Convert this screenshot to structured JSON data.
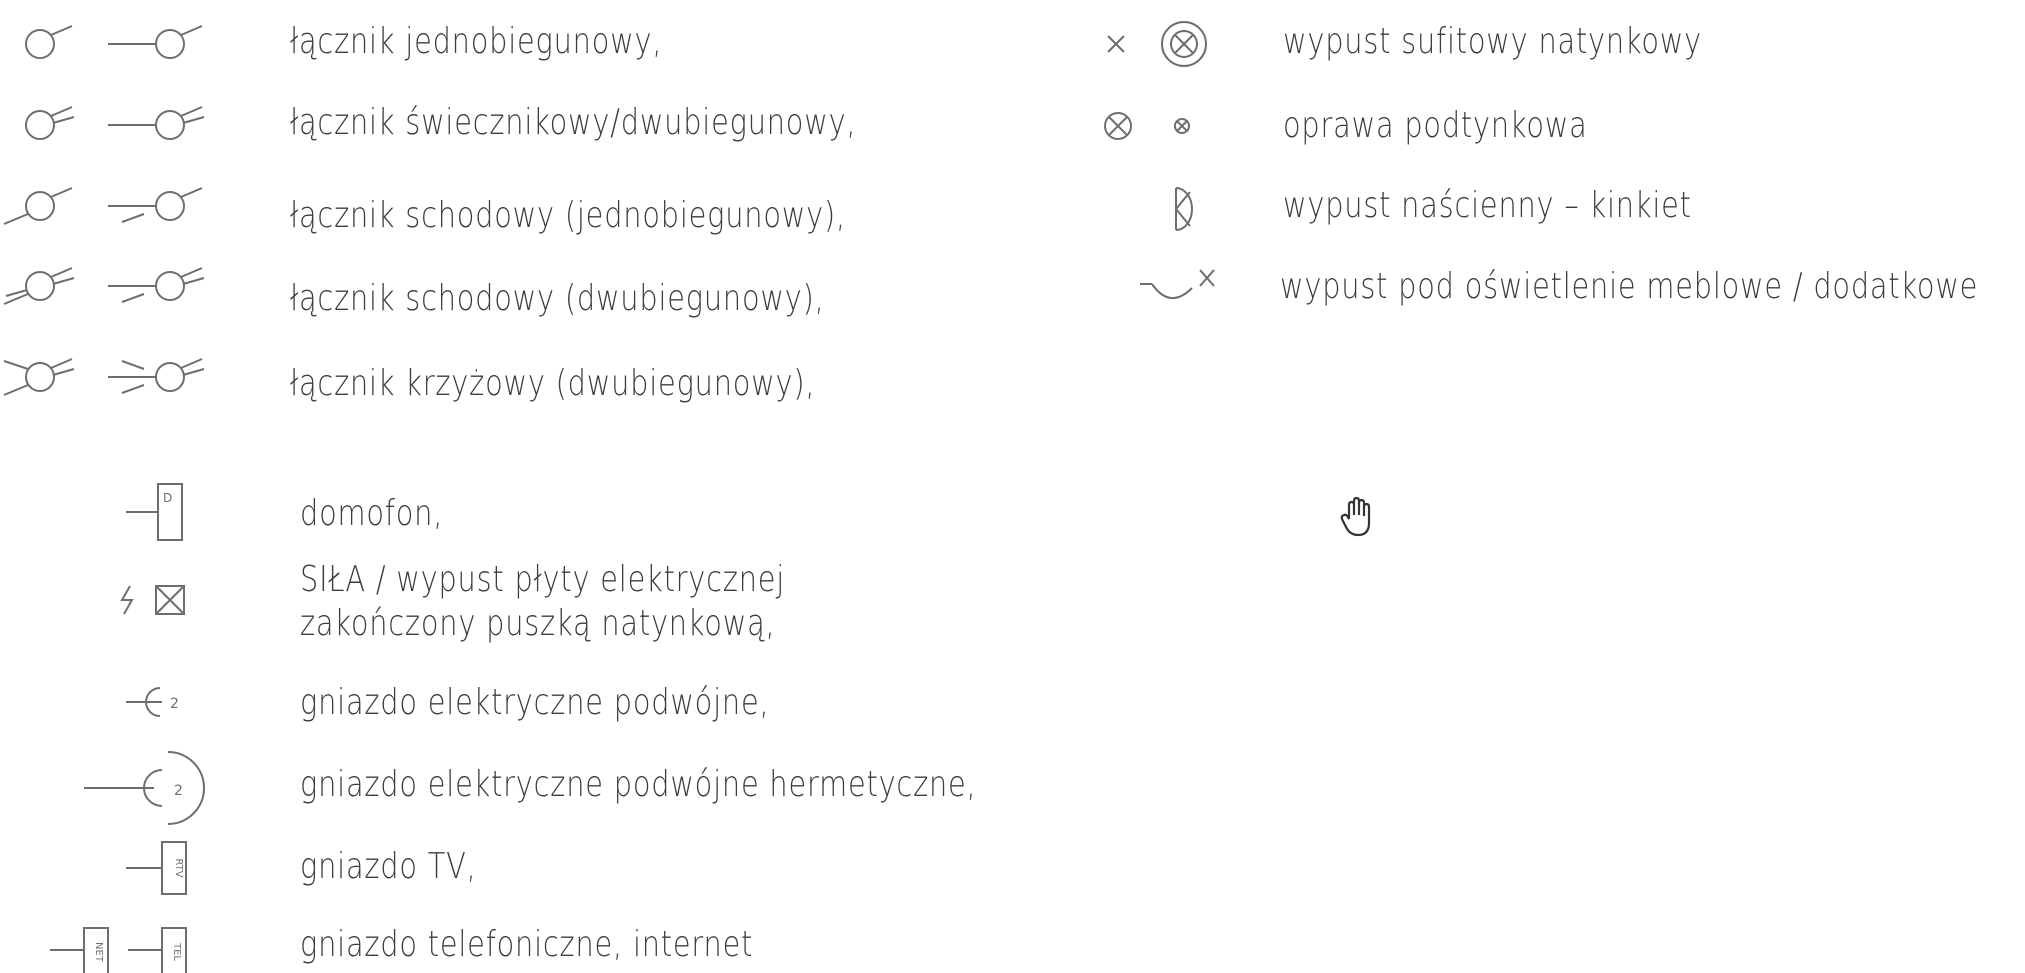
{
  "legend_left": [
    {
      "id": "switch-single-pole",
      "label": "łącznik jednobiegunowy,"
    },
    {
      "id": "switch-chandelier",
      "label": "łącznik świecznikowy/dwubiegunowy,"
    },
    {
      "id": "switch-stair-single",
      "label": "łącznik schodowy (jednobiegunowy),"
    },
    {
      "id": "switch-stair-double",
      "label": "łącznik schodowy (dwubiegunowy),"
    },
    {
      "id": "switch-cross",
      "label": "łącznik krzyżowy (dwubiegunowy),"
    },
    {
      "id": "intercom",
      "label": "domofon,",
      "tag": "D"
    },
    {
      "id": "power-outlet",
      "label_line1": "SIŁA / wypust  płyty elektrycznej",
      "label_line2": "zakończony puszką natynkową,"
    },
    {
      "id": "socket-double",
      "label": "gniazdo elektryczne podwójne,",
      "tag": "2"
    },
    {
      "id": "socket-double-hermetic",
      "label": "gniazdo elektryczne podwójne hermetyczne,",
      "tag": "2"
    },
    {
      "id": "socket-tv",
      "label": "gniazdo TV,",
      "tag": "RTV"
    },
    {
      "id": "socket-phone-net",
      "label": "gniazdo telefoniczne, internet",
      "tag_a": "NET",
      "tag_b": "TEL"
    }
  ],
  "legend_right": [
    {
      "id": "ceiling-outlet",
      "label": "wypust sufitowy natynkowy"
    },
    {
      "id": "recessed-fixture",
      "label": "oprawa podtynkowa"
    },
    {
      "id": "wall-outlet",
      "label": "wypust naścienny – kinkiet"
    },
    {
      "id": "furniture-light",
      "label": "wypust pod oświetlenie meblowe / dodatkowe"
    }
  ],
  "colors": {
    "ink": "#3c3c3c",
    "symbol": "#6e6e6e",
    "background": "#ffffff"
  },
  "cursor_icon": "hand-cursor-icon"
}
